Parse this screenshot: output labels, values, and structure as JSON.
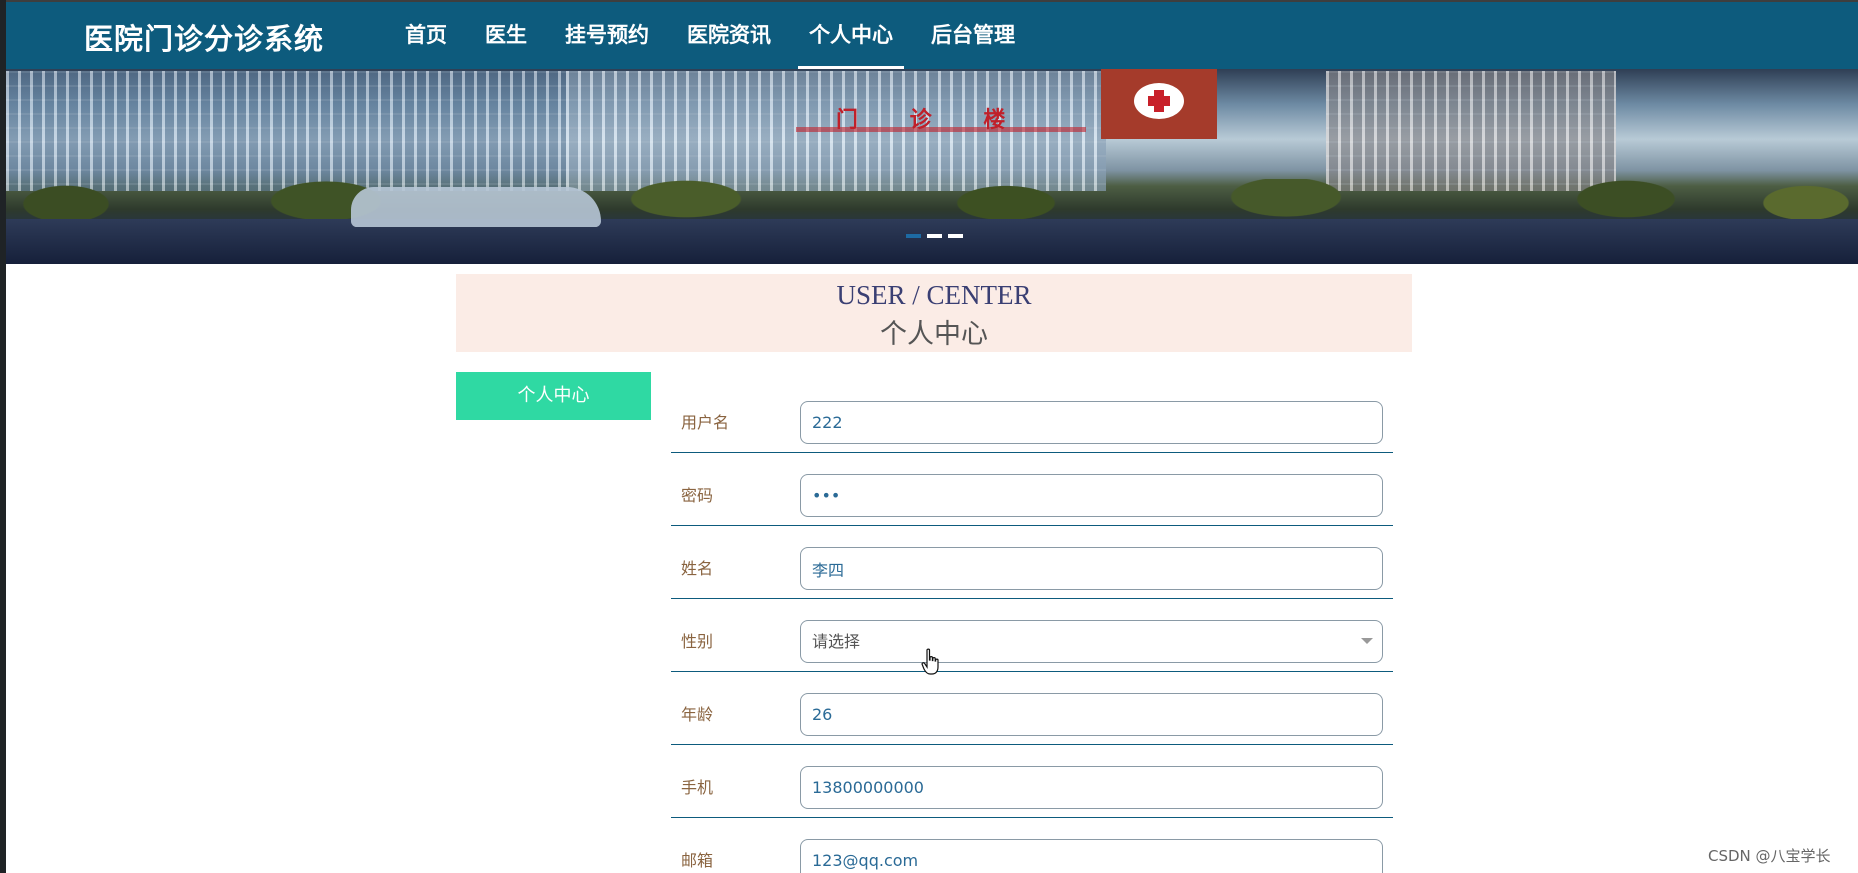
{
  "app": {
    "title": "医院门诊分诊系统"
  },
  "nav": {
    "items": [
      {
        "label": "首页",
        "active": false
      },
      {
        "label": "医生",
        "active": false
      },
      {
        "label": "挂号预约",
        "active": false
      },
      {
        "label": "医院资讯",
        "active": false
      },
      {
        "label": "个人中心",
        "active": true
      },
      {
        "label": "后台管理",
        "active": false
      }
    ]
  },
  "banner": {
    "sign_text": "门 诊 楼",
    "dots": [
      {
        "active": true
      },
      {
        "active": false
      },
      {
        "active": false
      }
    ]
  },
  "section": {
    "title_en": "USER / CENTER",
    "title_cn": "个人中心"
  },
  "sidebar": {
    "button_label": "个人中心"
  },
  "form": {
    "fields": [
      {
        "label": "用户名",
        "value": "222",
        "type": "text"
      },
      {
        "label": "密码",
        "value": "•••",
        "type": "password"
      },
      {
        "label": "姓名",
        "value": "李四",
        "type": "text"
      },
      {
        "label": "性别",
        "value": "请选择",
        "type": "select"
      },
      {
        "label": "年龄",
        "value": "26",
        "type": "text"
      },
      {
        "label": "手机",
        "value": "13800000000",
        "type": "text"
      },
      {
        "label": "邮箱",
        "value": "123@qq.com",
        "type": "text"
      }
    ]
  },
  "colors": {
    "nav_bg": "#0d5b7d",
    "accent_button": "#2fd9a3",
    "title_bg": "#fbece6",
    "label_text": "#8a6440",
    "value_text": "#2a6a96"
  },
  "watermark": "CSDN @八宝学长"
}
